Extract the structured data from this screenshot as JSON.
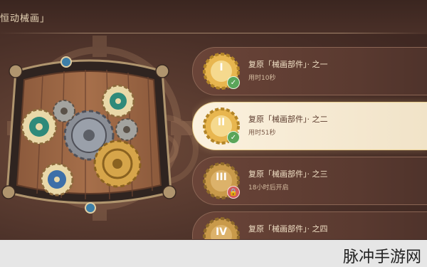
{
  "header": {
    "mode_title": "恒动械画」"
  },
  "quests": [
    {
      "title": "复原「械画部件」· 之一",
      "sub": "用时10秒",
      "numeral": "I",
      "status": "complete",
      "selected": false
    },
    {
      "title": "复原「械画部件」· 之二",
      "sub": "用时51秒",
      "numeral": "II",
      "status": "complete",
      "selected": true
    },
    {
      "title": "复原「械画部件」· 之三",
      "sub": "18小时后开启",
      "numeral": "III",
      "status": "locked",
      "selected": false
    },
    {
      "title": "复原「械画部件」· 之四",
      "sub": "",
      "numeral": "IV",
      "status": "locked",
      "selected": false
    }
  ],
  "watermark": {
    "text": "脉冲手游网"
  },
  "colors": {
    "accent_gold": "#e8b64f",
    "complete_green": "#5aa55a",
    "locked_red": "#d25a5a",
    "selected_bg": "#fbf1de"
  },
  "icons": {
    "complete": "check-icon",
    "locked": "lock-icon"
  }
}
